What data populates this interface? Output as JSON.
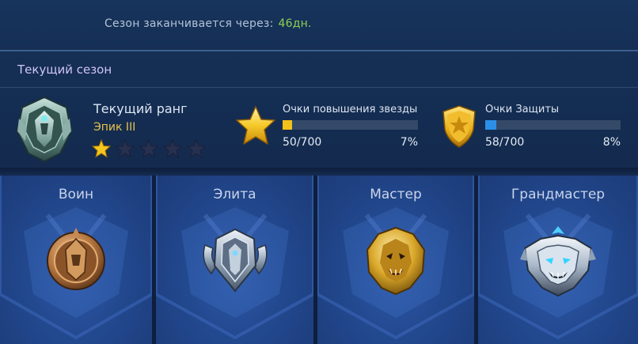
{
  "season_end": {
    "label": "Сезон заканчивается через:",
    "days": "46дн."
  },
  "current_season": {
    "label": "Текущий сезон",
    "rank_title": "Текущий ранг",
    "rank_value": "Эпик III",
    "stars_filled": 1,
    "stars_total": 5
  },
  "star_points": {
    "label": "Очки повышения звезды",
    "count": "50/700",
    "percent": "7%",
    "fill_fraction": 0.07,
    "fill_color": "#f2c21a",
    "icon": "gold-star-icon"
  },
  "protection_points": {
    "label": "Очки Защиты",
    "count": "58/700",
    "percent": "8%",
    "fill_fraction": 0.08,
    "fill_color": "#2b8fe8",
    "icon": "shield-star-icon"
  },
  "tiers": [
    {
      "name": "Воин",
      "icon": "warrior-emblem-icon"
    },
    {
      "name": "Элита",
      "icon": "elite-emblem-icon"
    },
    {
      "name": "Мастер",
      "icon": "master-emblem-icon"
    },
    {
      "name": "Грандмастер",
      "icon": "grandmaster-emblem-icon"
    }
  ]
}
